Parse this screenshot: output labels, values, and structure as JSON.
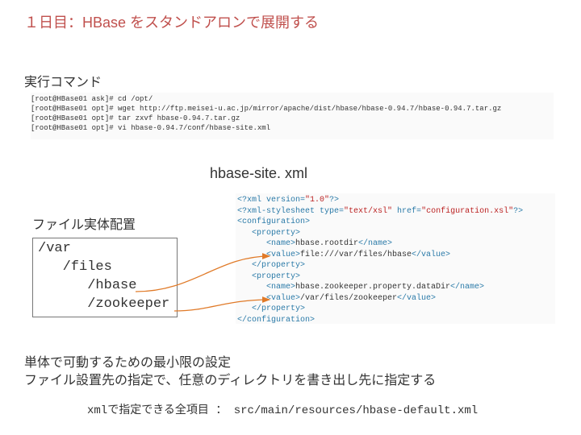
{
  "title": "１日目：HBase をスタンドアロンで展開する",
  "exec_label": "実行コマンド",
  "cmds": [
    "[root@HBase01 ask]# cd /opt/",
    "[root@HBase01 opt]# wget http://ftp.meisei-u.ac.jp/mirror/apache/dist/hbase/hbase-0.94.7/hbase-0.94.7.tar.gz",
    "[root@HBase01 opt]# tar zxvf hbase-0.94.7.tar.gz",
    "[root@HBase01 opt]# vi hbase-0.94.7/conf/hbase-site.xml"
  ],
  "site_label": "hbase-site. xml",
  "file_label": "ファイル実体配置",
  "tree": "/var\n   /files\n      /hbase\n      /zookeeper",
  "xml": {
    "l1a": "<?xml version=",
    "l1b": "\"1.0\"",
    "l1c": "?>",
    "l2a": "<?xml-stylesheet type=",
    "l2b": "\"text/xsl\"",
    "l2c": " href=",
    "l2d": "\"configuration.xsl\"",
    "l2e": "?>",
    "l3": "<configuration>",
    "l4": "   <property>",
    "l5a": "      <name>",
    "l5b": "hbase.rootdir",
    "l5c": "</name>",
    "l6a": "      <value>",
    "l6b": "file:///var/files/hbase",
    "l6c": "</value>",
    "l7": "   </property>",
    "l8": "   <property>",
    "l9a": "      <name>",
    "l9b": "hbase.zookeeper.property.dataDir",
    "l9c": "</name>",
    "l10a": "      <value>",
    "l10b": "/var/files/zookeeper",
    "l10c": "</value>",
    "l11": "   </property>",
    "l12": "</configuration>"
  },
  "note1": "単体で可動するための最小限の設定",
  "note2": "ファイル設置先の指定で、任意のディレクトリを書き出し先に指定する",
  "footnote": "xmlで指定できる全項目 ： src/main/resources/hbase-default.xml"
}
